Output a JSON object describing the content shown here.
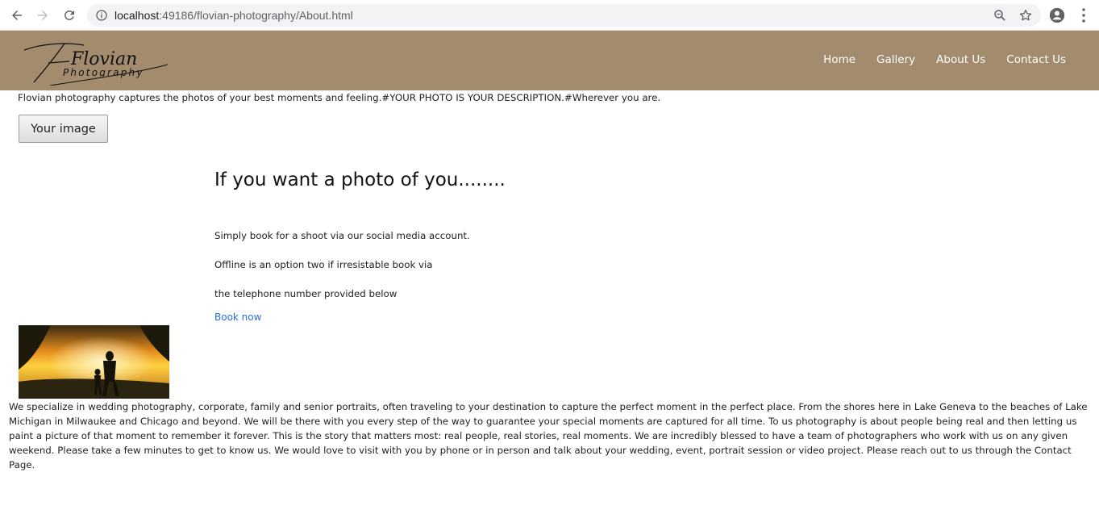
{
  "browser": {
    "url_host": "localhost",
    "url_path": ":49186/flovian-photography/About.html"
  },
  "site": {
    "logo_title": "Flovian",
    "logo_subtitle": "Photography",
    "nav": [
      "Home",
      "Gallery",
      "About Us",
      "Contact Us"
    ]
  },
  "content": {
    "intro": "Flovian photography captures the photos of your best moments and feeling.#YOUR PHOTO IS YOUR DESCRIPTION.#Wherever you are.",
    "image_button": "Your image",
    "heading": "If you want a photo of you........",
    "lines": [
      "Simply book for a shoot via our social media account.",
      "Offline is an option two if irresistable book via",
      "the telephone number provided below"
    ],
    "book_link": "Book now",
    "about": "We specialize in wedding photography, corporate, family and senior portraits, often traveling to your destination to capture the perfect moment in the perfect place. From the shores here in Lake Geneva to the beaches of Lake Michigan in Milwaukee and Chicago and beyond. We will be there with you every step of the way to guarantee your special moments are captured for all time. To us photography is about people being real and then letting us paint a picture of that moment to remember it forever. This is the story that matters most: real people, real stories, real moments. We are incredibly blessed to have a team of photographers who work with us on any given weekend. Please take a few minutes to get to know us. We would love to visit with you by phone or in person and talk about your wedding, event, portrait session or video project. Please reach out to us through the Contact Page."
  },
  "colors": {
    "header_bg": "#a38b6d",
    "link": "#2a6fd6"
  }
}
